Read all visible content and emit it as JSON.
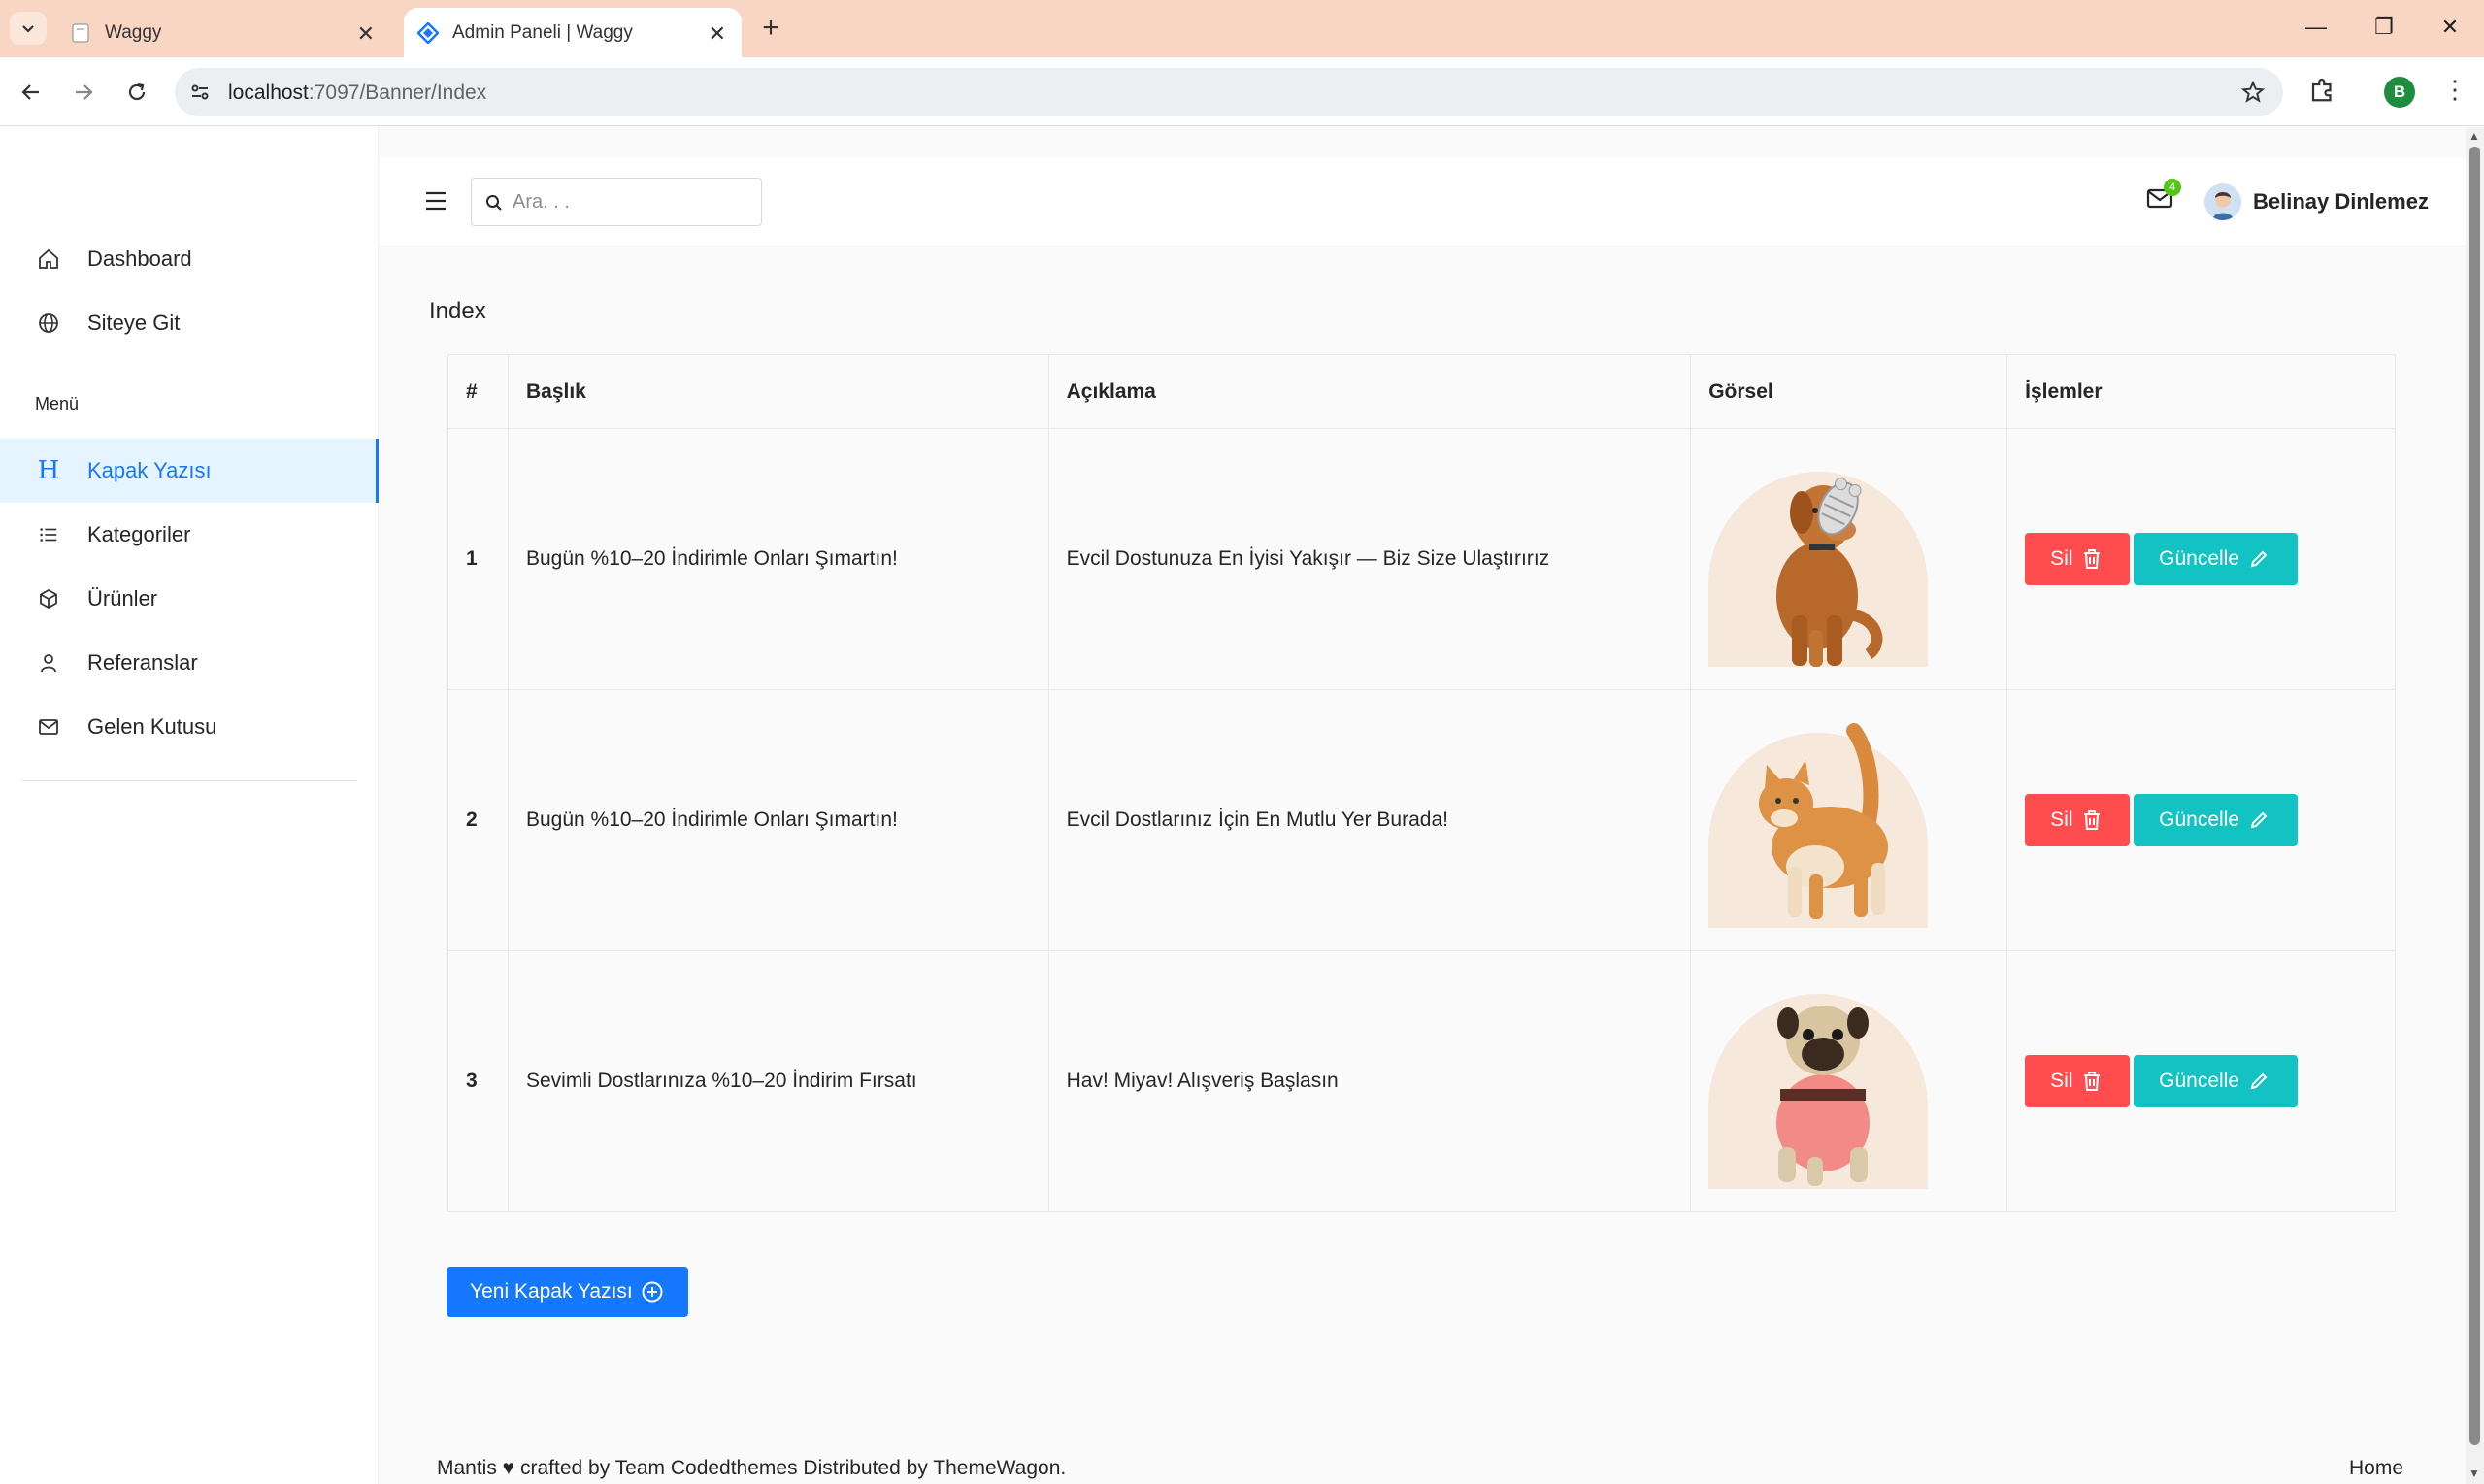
{
  "browser": {
    "tabs": [
      {
        "title": "Waggy",
        "active": false
      },
      {
        "title": "Admin Paneli | Waggy",
        "active": true
      }
    ],
    "url_host": "localhost",
    "url_path": ":7097/Banner/Index",
    "profile_initial": "B"
  },
  "sidebar": {
    "top_items": [
      {
        "label": "Dashboard",
        "icon": "home-icon"
      },
      {
        "label": "Siteye Git",
        "icon": "globe-icon"
      }
    ],
    "caption": "Menü",
    "menu_items": [
      {
        "label": "Kapak Yazısı",
        "icon": "heading-icon",
        "active": true
      },
      {
        "label": "Kategoriler",
        "icon": "list-icon"
      },
      {
        "label": "Ürünler",
        "icon": "box-icon"
      },
      {
        "label": "Referanslar",
        "icon": "user-icon"
      },
      {
        "label": "Gelen Kutusu",
        "icon": "mail-icon"
      }
    ]
  },
  "header": {
    "search_placeholder": "Ara. . .",
    "mail_badge": "4",
    "username": "Belinay Dinlemez"
  },
  "page": {
    "title": "Index",
    "table": {
      "columns": [
        "#",
        "Başlık",
        "Açıklama",
        "Görsel",
        "İşlemler"
      ],
      "rows": [
        {
          "num": "1",
          "title": "Bugün %10–20 İndirimle Onları Şımartın!",
          "description": "Evcil Dostunuza En İyisi Yakışır — Biz Size Ulaştırırız",
          "image": "dog-with-toy"
        },
        {
          "num": "2",
          "title": "Bugün %10–20 İndirimle Onları Şımartın!",
          "description": "Evcil Dostlarınız İçin En Mutlu Yer Burada!",
          "image": "orange-cat"
        },
        {
          "num": "3",
          "title": "Sevimli Dostlarınıza %10–20 İndirim Fırsatı",
          "description": "Hav! Miyav! Alışveriş Başlasın",
          "image": "pug-in-sweater"
        }
      ],
      "delete_label": "Sil",
      "update_label": "Güncelle"
    },
    "new_button": "Yeni Kapak Yazısı"
  },
  "footer": {
    "text": "Mantis ♥ crafted by Team Codedthemes Distributed by ThemeWagon.",
    "link": "Home"
  },
  "colors": {
    "primary": "#1677ff",
    "danger": "#ff4d4f",
    "info": "#13c2c2",
    "tabbar": "#f9d6c4"
  }
}
